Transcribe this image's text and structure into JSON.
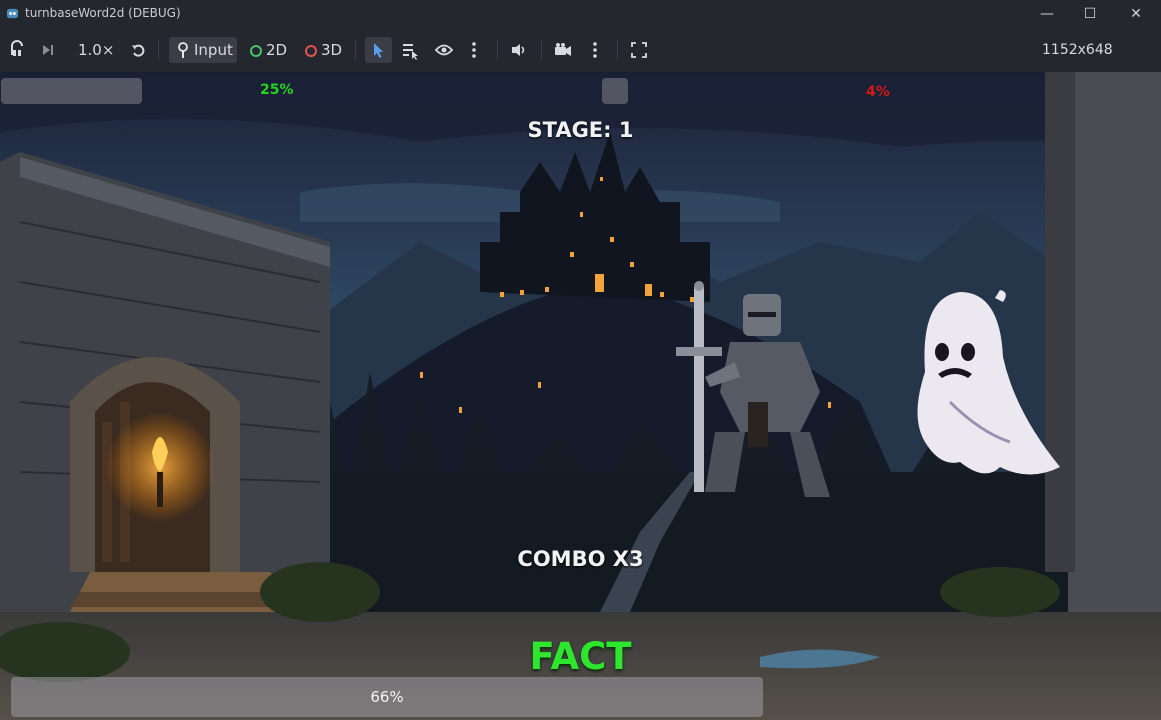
{
  "window": {
    "title": "turnbaseWord2d (DEBUG)",
    "controls": {
      "minimize": "—",
      "maximize": "☐",
      "close": "✕"
    }
  },
  "toolbar": {
    "speed": "1.0×",
    "input_label": "Input",
    "mode_2d": "2D",
    "mode_3d": "3D",
    "resolution": "1152x648",
    "icons": [
      "suspend-icon",
      "next-frame-icon",
      "reset-speed-icon",
      "input-icon",
      "select-icon",
      "list-select-icon",
      "visibility-icon",
      "more-icon",
      "audio-icon",
      "camera-icon",
      "more-icon",
      "embed-icon"
    ],
    "colors": {
      "dot_2d": "#46c46a",
      "dot_3d": "#e0524f",
      "select_active": "#5a9ef0"
    }
  },
  "game": {
    "player_hp": {
      "label": "25%",
      "value": 0.25,
      "color": "#22d422"
    },
    "enemy_hp": {
      "label": "4%",
      "value": 0.04,
      "color": "#d41818"
    },
    "stage_text": "STAGE: 1",
    "combo_text": "COMBO X3",
    "word": "FACT",
    "word_color": "#2ee62e",
    "timer": {
      "label": "66%",
      "value": 0.66
    }
  }
}
